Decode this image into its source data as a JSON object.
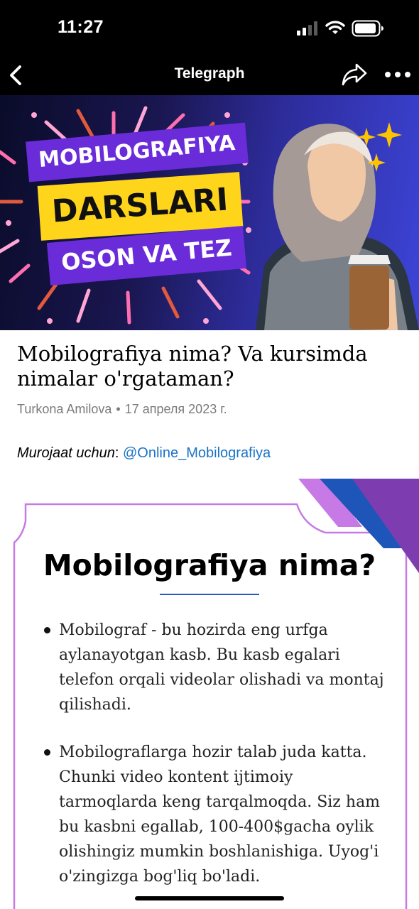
{
  "status_bar": {
    "time": "11:27",
    "icons": [
      "signal-icon",
      "wifi-icon",
      "battery-icon"
    ]
  },
  "nav": {
    "title": "Telegraph",
    "icons": [
      "back-icon",
      "share-icon",
      "more-icon"
    ]
  },
  "banner": {
    "line1": "MOBILOGRAFIYA",
    "line2": "DARSLARI",
    "line3": "OSON VA TEZ",
    "colors": {
      "purple": "#6a2bd9",
      "yellow": "#ffd51c",
      "sparkle": "#ffc400"
    },
    "icons": [
      "sparkle-icon"
    ]
  },
  "article": {
    "title": "Mobilografiya nima? Va kursimda nimalar o'rgataman?",
    "author": "Turkona Amilova",
    "separator": "•",
    "date": "17 апреля 2023 г.",
    "contact_label": "Murojaat uchun",
    "contact_colon": ":",
    "contact_link": "@Online_Mobilografiya"
  },
  "infographic": {
    "heading": "Mobilografiya nima?",
    "bullets": [
      "Mobilograf - bu hozirda eng urfga aylanayotgan kasb. Bu kasb egalari telefon orqali videolar olishadi va montaj qilishadi.",
      "Mobilograflarga hozir talab juda katta. Chunki video kontent ijtimoiy tarmoqlarda keng tarqalmoqda. Siz ham bu kasbni egallab, 100-400$gacha oylik olishingiz mumkin boshlanishiga. Uyog'i o'zingizga bog'liq bo'ladi."
    ],
    "colors": {
      "frame": "#c77ae6",
      "accent_blue": "#1e55b8",
      "accent_purple": "#7d3db0",
      "link": "#1a73c6"
    }
  }
}
